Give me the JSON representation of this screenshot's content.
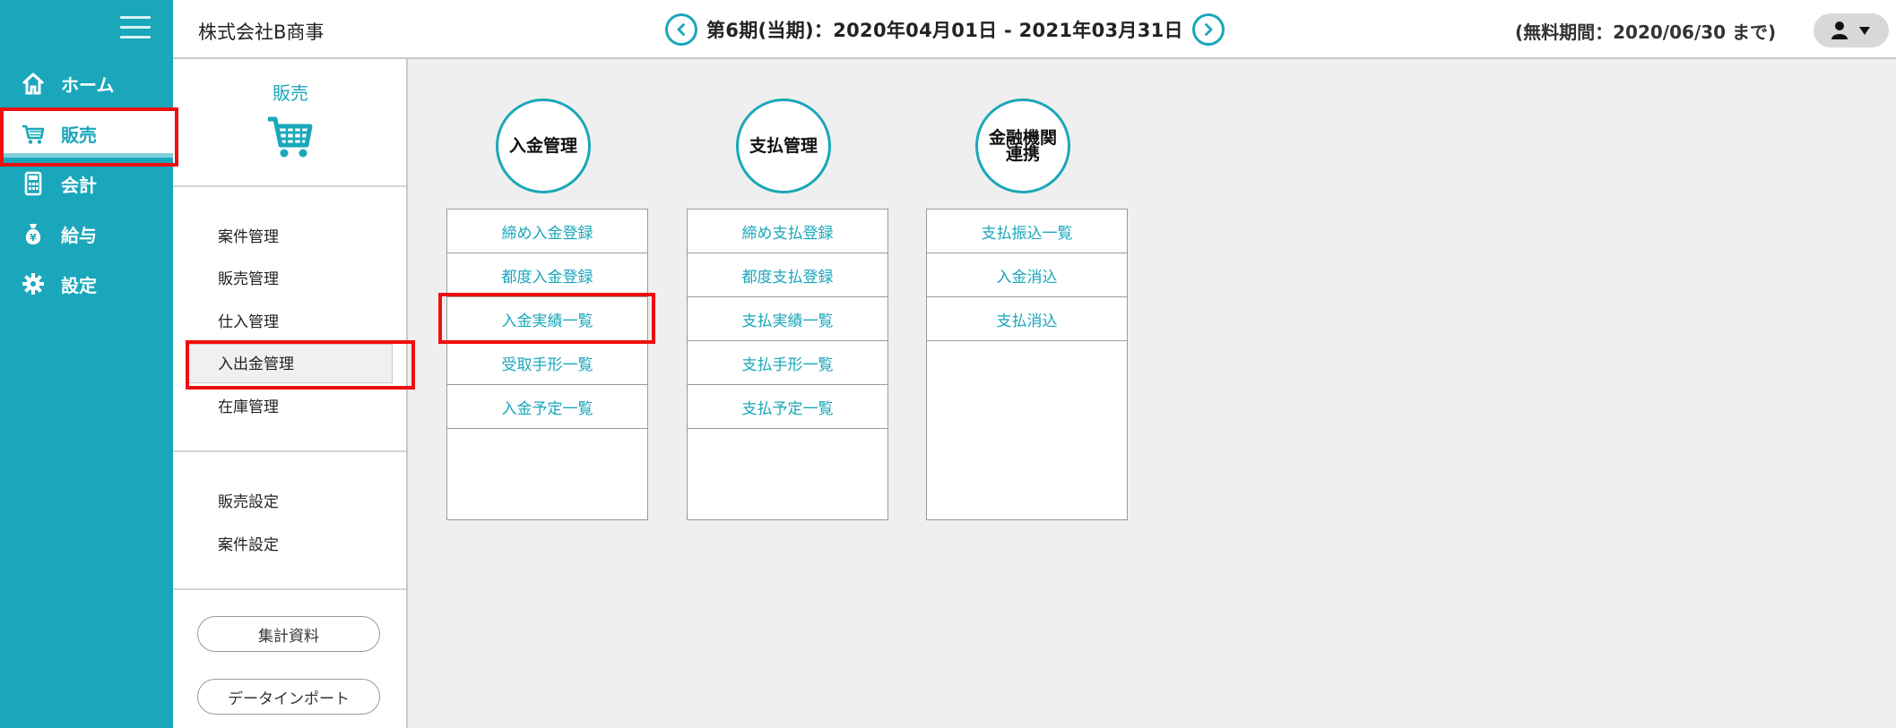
{
  "nav": {
    "items": [
      {
        "label": "ホーム",
        "icon": "home-icon"
      },
      {
        "label": "販売",
        "icon": "cart-icon",
        "active": true
      },
      {
        "label": "会計",
        "icon": "calculator-icon"
      },
      {
        "label": "給与",
        "icon": "money-bag-icon"
      },
      {
        "label": "設定",
        "icon": "gear-icon"
      }
    ]
  },
  "header": {
    "company": "株式会社B商事",
    "period": "第6期(当期)：2020年04月01日 - 2021年03月31日",
    "trial": "(無料期間：2020/06/30 まで)"
  },
  "sub": {
    "title": "販売",
    "group1": [
      "案件管理",
      "販売管理",
      "仕入管理",
      "入出金管理",
      "在庫管理"
    ],
    "group2": [
      "販売設定",
      "案件設定"
    ],
    "buttons": [
      "集計資料",
      "データインポート"
    ]
  },
  "main": {
    "columns": [
      {
        "title_lines": [
          "入金管理"
        ],
        "items": [
          "締め入金登録",
          "都度入金登録",
          "入金実績一覧",
          "受取手形一覧",
          "入金予定一覧"
        ]
      },
      {
        "title_lines": [
          "支払管理"
        ],
        "items": [
          "締め支払登録",
          "都度支払登録",
          "支払実績一覧",
          "支払手形一覧",
          "支払予定一覧"
        ]
      },
      {
        "title_lines": [
          "金融機関",
          "連携"
        ],
        "items": [
          "支払振込一覧",
          "入金消込",
          "支払消込"
        ]
      }
    ]
  },
  "colors": {
    "accent": "#1aa7bb",
    "highlight": "#ee0f0f"
  }
}
